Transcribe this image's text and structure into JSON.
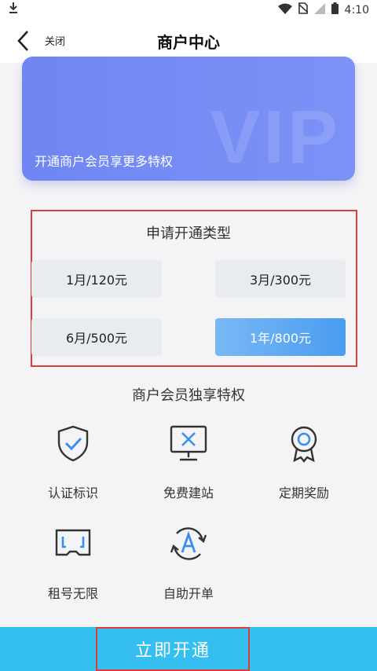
{
  "status_bar": {
    "time": "4:10",
    "icons": [
      "download-icon",
      "wifi-icon",
      "no-sim-icon",
      "signal-icon",
      "battery-icon"
    ]
  },
  "nav": {
    "back_icon": "chevron-left-icon",
    "close_label": "关闭",
    "title": "商户中心"
  },
  "vip_card": {
    "watermark": "VIP",
    "description": "开通商户会员享更多特权"
  },
  "plans": {
    "title": "申请开通类型",
    "items": [
      {
        "label": "1月/120元",
        "selected": false
      },
      {
        "label": "3月/300元",
        "selected": false
      },
      {
        "label": "6月/500元",
        "selected": false
      },
      {
        "label": "1年/800元",
        "selected": true
      }
    ]
  },
  "privileges": {
    "title": "商户会员独享特权",
    "items": [
      {
        "label": "认证标识",
        "icon": "shield-check-icon"
      },
      {
        "label": "免费建站",
        "icon": "monitor-tools-icon"
      },
      {
        "label": "定期奖励",
        "icon": "award-ribbon-icon"
      },
      {
        "label": "租号无限",
        "icon": "scan-frame-icon"
      },
      {
        "label": "自助开单",
        "icon": "auto-refresh-icon"
      }
    ]
  },
  "cta": {
    "label": "立即开通"
  },
  "colors": {
    "accent": "#35bff0",
    "card": "#7d92f6",
    "selected": "#4a9cf0",
    "highlight_border": "#e23b3b"
  }
}
